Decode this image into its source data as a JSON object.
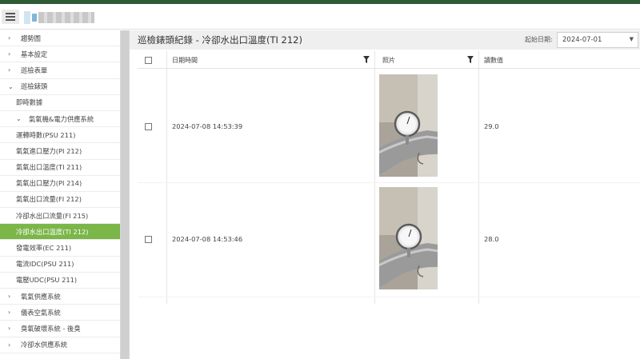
{
  "header": {
    "title": "巡檢錶頭紀錄 - 冷卻水出口溫度(TI 212)",
    "date_label": "起始日期:",
    "date_value": "2024-07-01"
  },
  "sidebar": {
    "items": [
      {
        "label": "趨勢圖",
        "chevron": "›"
      },
      {
        "label": "基本設定",
        "chevron": "›"
      },
      {
        "label": "巡檢表單",
        "chevron": "›"
      },
      {
        "label": "巡檢錶頭",
        "chevron": "⌄"
      },
      {
        "label": "即時數據"
      },
      {
        "label": "氣氧機&電力供應系統",
        "chevron": "⌄"
      },
      {
        "label": "運轉時數(PSU 211)"
      },
      {
        "label": "氧氣進口壓力(PI 212)"
      },
      {
        "label": "氣氧出口溫度(TI 211)"
      },
      {
        "label": "氣氧出口壓力(PI 214)"
      },
      {
        "label": "氣氧出口流量(FI 212)"
      },
      {
        "label": "冷卻水出口流量(FI 215)"
      },
      {
        "label": "冷卻水出口溫度(TI 212)"
      },
      {
        "label": "發電效率(EC 211)"
      },
      {
        "label": "電流IDC(PSU 211)"
      },
      {
        "label": "電壓UDC(PSU 211)"
      },
      {
        "label": "氧氣供應系統",
        "chevron": "›"
      },
      {
        "label": "儀表空氣系統",
        "chevron": "›"
      },
      {
        "label": "臭氧破壞系統 - 後臭",
        "chevron": "›"
      },
      {
        "label": "冷卻水供應系統",
        "chevron": "›"
      }
    ]
  },
  "table": {
    "columns": [
      "日期時間",
      "照片",
      "讀數值"
    ],
    "rows": [
      {
        "datetime": "2024-07-08 14:53:39",
        "value": "29.0"
      },
      {
        "datetime": "2024-07-08 14:53:46",
        "value": "28.0"
      }
    ]
  },
  "colors": {
    "accent": "#7ab648",
    "top_stripe": "#2e5b36"
  }
}
